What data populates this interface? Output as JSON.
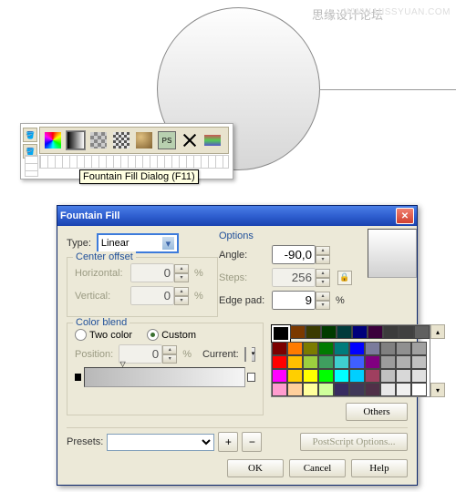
{
  "watermark1": "思缘设计论坛",
  "watermark2": "WWW.MISSYUAN.COM",
  "tooltip": "Fountain Fill Dialog (F11)",
  "dialog": {
    "title": "Fountain Fill",
    "type_label": "Type:",
    "type_value": "Linear",
    "center_offset_legend": "Center offset",
    "horizontal_label": "Horizontal:",
    "horizontal_value": "0",
    "vertical_label": "Vertical:",
    "vertical_value": "0",
    "percent": "%",
    "options_label": "Options",
    "angle_label": "Angle:",
    "angle_value": "-90,0",
    "steps_label": "Steps:",
    "steps_value": "256",
    "edgepad_label": "Edge pad:",
    "edgepad_value": "9",
    "colorblend_legend": "Color blend",
    "twocolor_label": "Two color",
    "custom_label": "Custom",
    "position_label": "Position:",
    "position_value": "0",
    "current_label": "Current:",
    "others_btn": "Others",
    "presets_label": "Presets:",
    "postscript_btn": "PostScript Options...",
    "ok": "OK",
    "cancel": "Cancel",
    "help": "Help"
  },
  "palette": [
    [
      "#000000",
      "#7b3900",
      "#3b3b00",
      "#003b00",
      "#003b3b",
      "#00007b",
      "#3b003b",
      "#3b3b3b",
      "#404040",
      "#606060"
    ],
    [
      "#7b0000",
      "#ff7b00",
      "#7b7b00",
      "#007b00",
      "#007b7b",
      "#0000ff",
      "#7b7b9c",
      "#808080",
      "#909090",
      "#a0a0a0"
    ],
    [
      "#ff0000",
      "#ffbf00",
      "#9ccf3f",
      "#3f9f5f",
      "#3fcfcf",
      "#3f5fff",
      "#800080",
      "#9c9c9c",
      "#b0b0b0",
      "#c0c0c0"
    ],
    [
      "#ff00ff",
      "#ffcf00",
      "#ffff00",
      "#00ff00",
      "#00ffff",
      "#00cfff",
      "#9f3f5f",
      "#c0c0c0",
      "#d8d8d8",
      "#e0e0e0"
    ],
    [
      "#ff9ccf",
      "#ffcf9c",
      "#ffff9c",
      "#cfff9c",
      "#382c60",
      "#403858",
      "#503048",
      "#e8e8e8",
      "#f0f0f0",
      "#ffffff"
    ]
  ]
}
